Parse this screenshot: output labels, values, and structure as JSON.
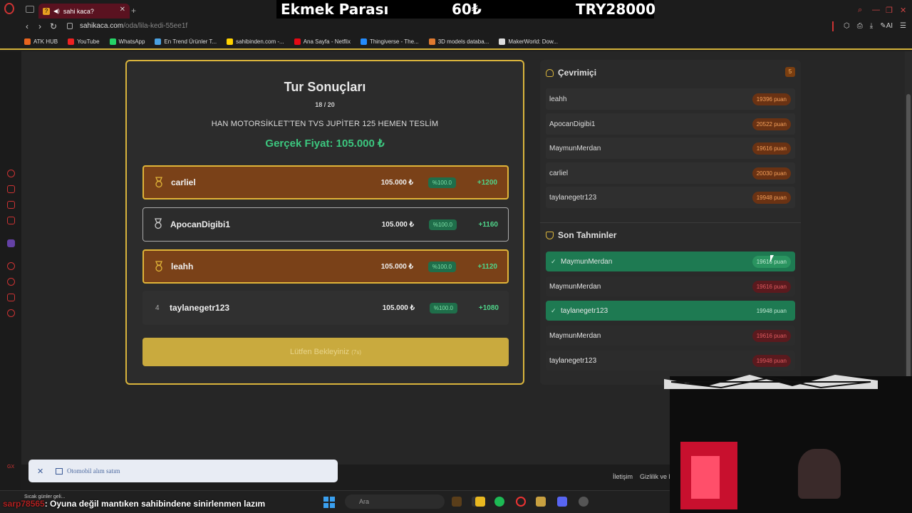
{
  "browser": {
    "tab_title": "sahi kaca?",
    "tab_favicon": "?",
    "url_host": "sahikaca.com",
    "url_path": "/oda/lila-kedi-55ee1f",
    "bookmarks": [
      {
        "label": "ATK HUB",
        "color": "#e8641e"
      },
      {
        "label": "YouTube",
        "color": "#e22"
      },
      {
        "label": "WhatsApp",
        "color": "#25d366"
      },
      {
        "label": "En Trend Ürünler T...",
        "color": "#4aa0e0"
      },
      {
        "label": "sahibinden.com -...",
        "color": "#ffd200"
      },
      {
        "label": "Ana Sayfa - Netflix",
        "color": "#e50914"
      },
      {
        "label": "Thingiverse - The...",
        "color": "#248bfb"
      },
      {
        "label": "3D models databa...",
        "color": "#e07a30"
      },
      {
        "label": "MakerWorld: Dow...",
        "color": "#ddd"
      }
    ]
  },
  "stream_overlay": {
    "label": "Ekmek Parası",
    "price": "60₺",
    "total": "TRY28000"
  },
  "results": {
    "title": "Tur Sonuçları",
    "round": "18 / 20",
    "product": "HAN MOTORSİKLET'TEN TVS JUPİTER 125 HEMEN TESLİM",
    "actual_price": "Gerçek Fiyat: 105.000 ₺",
    "rows": [
      {
        "rank": "",
        "name": "carliel",
        "guess": "105.000 ₺",
        "accuracy": "%100.0",
        "points": "+1200"
      },
      {
        "rank": "",
        "name": "ApocanDigibi1",
        "guess": "105.000 ₺",
        "accuracy": "%100.0",
        "points": "+1160"
      },
      {
        "rank": "",
        "name": "leahh",
        "guess": "105.000 ₺",
        "accuracy": "%100.0",
        "points": "+1120"
      },
      {
        "rank": "4",
        "name": "taylanegetr123",
        "guess": "105.000 ₺",
        "accuracy": "%100.0",
        "points": "+1080"
      }
    ],
    "wait_label": "Lütfen Bekleyiniz",
    "wait_timer": "(7s)"
  },
  "online": {
    "title": "Çevrimiçi",
    "count": "5",
    "users": [
      {
        "name": "leahh",
        "score": "19396 puan"
      },
      {
        "name": "ApocanDigibi1",
        "score": "20522 puan"
      },
      {
        "name": "MaymunMerdan",
        "score": "19616 puan"
      },
      {
        "name": "carliel",
        "score": "20030 puan"
      },
      {
        "name": "taylanegetr123",
        "score": "19948 puan"
      }
    ]
  },
  "recent": {
    "title": "Son Tahminler",
    "guesses": [
      {
        "name": "MaymunMerdan",
        "score": "19616 puan",
        "correct": true,
        "check": "✓"
      },
      {
        "name": "MaymunMerdan",
        "score": "19616 puan",
        "correct": false,
        "check": ""
      },
      {
        "name": "taylanegetr123",
        "score": "19948 puan",
        "correct": true,
        "check": "✓"
      },
      {
        "name": "MaymunMerdan",
        "score": "19616 puan",
        "correct": false,
        "check": ""
      },
      {
        "name": "taylanegetr123",
        "score": "19948 puan",
        "correct": false,
        "check": ""
      }
    ]
  },
  "footer": {
    "link1": "İletişim",
    "link2": "Gizlilik ve K"
  },
  "toast": {
    "text": "Otomobil alım satım"
  },
  "taskbar": {
    "weather": "Sıcak günler geli...",
    "search_placeholder": "Ara"
  },
  "chat": {
    "user": "sarp78565",
    "message": ": Oyuna değil mantıken sahibindene sinirlenmen lazım"
  }
}
